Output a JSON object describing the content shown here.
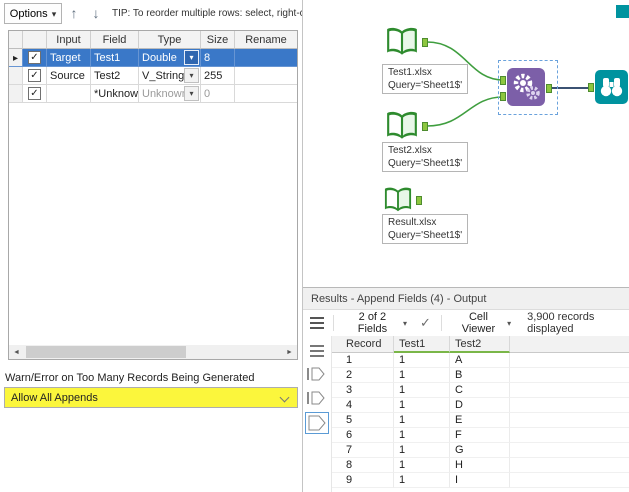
{
  "config": {
    "toolbar": {
      "options_label": "Options",
      "tip": "TIP: To reorder multiple rows: select, right-click"
    },
    "grid": {
      "headers": {
        "input": "Input",
        "field": "Field",
        "type": "Type",
        "size": "Size",
        "rename": "Rename"
      },
      "rows": [
        {
          "checked": true,
          "input": "Target",
          "field": "Test1",
          "type": "Double",
          "size": "8",
          "rename": ""
        },
        {
          "checked": true,
          "input": "Source",
          "field": "Test2",
          "type": "V_String",
          "size": "255",
          "rename": ""
        },
        {
          "checked": true,
          "input": "",
          "field": "*Unknown",
          "type": "Unknown",
          "size": "0",
          "rename": ""
        }
      ]
    },
    "warn_label": "Warn/Error on Too Many Records Being Generated",
    "append_mode_value": "Allow All Appends"
  },
  "canvas": {
    "tools": {
      "test1": {
        "title": "Test1.xlsx",
        "subtitle": "Query='Sheet1$'"
      },
      "test2": {
        "title": "Test2.xlsx",
        "subtitle": "Query='Sheet1$'"
      },
      "result": {
        "title": "Result.xlsx",
        "subtitle": "Query='Sheet1$'"
      }
    }
  },
  "results": {
    "title": "Results - Append Fields (4) - Output",
    "toolbar": {
      "fields_selector": "2 of 2 Fields",
      "cell_viewer_label": "Cell Viewer",
      "records_text": "3,900 records displayed"
    },
    "grid": {
      "headers": [
        "Record",
        "Test1",
        "Test2"
      ],
      "rows": [
        [
          "1",
          "1",
          "A"
        ],
        [
          "2",
          "1",
          "B"
        ],
        [
          "3",
          "1",
          "C"
        ],
        [
          "4",
          "1",
          "D"
        ],
        [
          "5",
          "1",
          "E"
        ],
        [
          "6",
          "1",
          "F"
        ],
        [
          "7",
          "1",
          "G"
        ],
        [
          "8",
          "1",
          "H"
        ],
        [
          "9",
          "1",
          "I"
        ]
      ]
    }
  },
  "colors": {
    "selection_blue": "#3a78c8",
    "highlight_yellow": "#fbf63c",
    "input_tool_green": "#2e8b2e",
    "append_tool_purple": "#7c5fa8",
    "browse_tool_teal": "#00939f",
    "wire_green": "#3f9e3f",
    "wire_dark": "#1f3a5f",
    "header_accent_green": "#7ab648"
  }
}
